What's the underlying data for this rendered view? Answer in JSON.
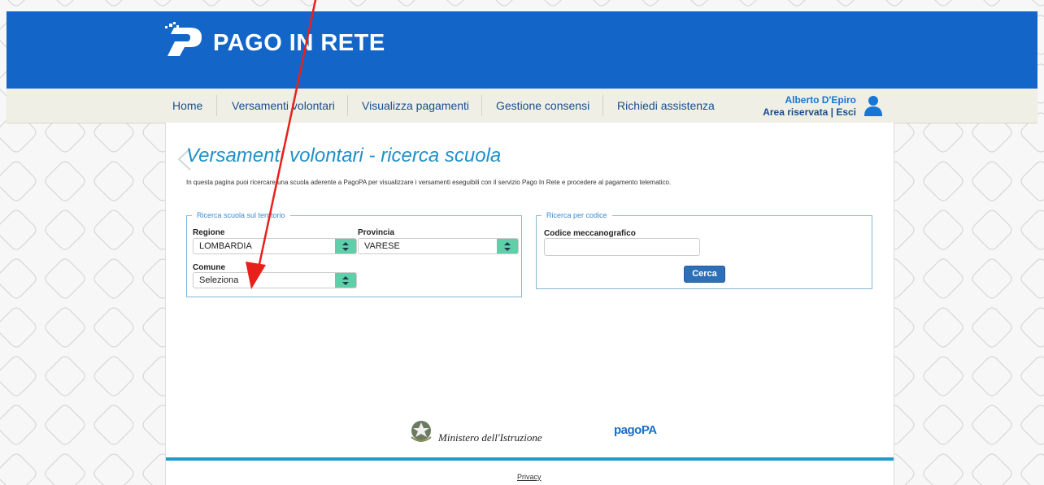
{
  "header": {
    "logo_text": "PAGO IN RETE"
  },
  "nav": {
    "items": [
      {
        "label": "Home"
      },
      {
        "label": "Versamenti volontari"
      },
      {
        "label": "Visualizza pagamenti"
      },
      {
        "label": "Gestione consensi"
      },
      {
        "label": "Richiedi assistenza"
      }
    ],
    "user_name": "Alberto D'Epiro",
    "area_riservata": "Area riservata",
    "separator": "|",
    "esci": "Esci"
  },
  "main": {
    "title": "Versamenti volontari - ricerca scuola",
    "intro": "In questa pagina puoi ricercare una scuola aderente a PagoPA per visualizzare i versamenti eseguibili con il servizio Pago In Rete e procedere al pagamento telematico.",
    "territory_box": {
      "legend": "Ricerca scuola sul territorio",
      "regione_label": "Regione",
      "regione_value": "LOMBARDIA",
      "provincia_label": "Provincia",
      "provincia_value": "VARESE",
      "comune_label": "Comune",
      "comune_value": "Seleziona"
    },
    "code_box": {
      "legend": "Ricerca per codice",
      "codice_label": "Codice meccanografico",
      "codice_value": "",
      "search_button": "Cerca"
    }
  },
  "footer": {
    "ministry": "Ministero dell'Istruzione",
    "pagopa": "pagoPA",
    "privacy": "Privacy"
  },
  "colors": {
    "header_blue": "#1366c8",
    "title_blue": "#2090c9",
    "select_arrow": "#5fcfaa",
    "button_blue": "#2e70b8",
    "annotation_red": "#e8201a"
  },
  "icons": {
    "logo": "pago-in-rete-logo-icon",
    "user": "user-icon",
    "select_arrow": "updown-arrow-icon",
    "ministry": "italian-emblem-icon"
  }
}
